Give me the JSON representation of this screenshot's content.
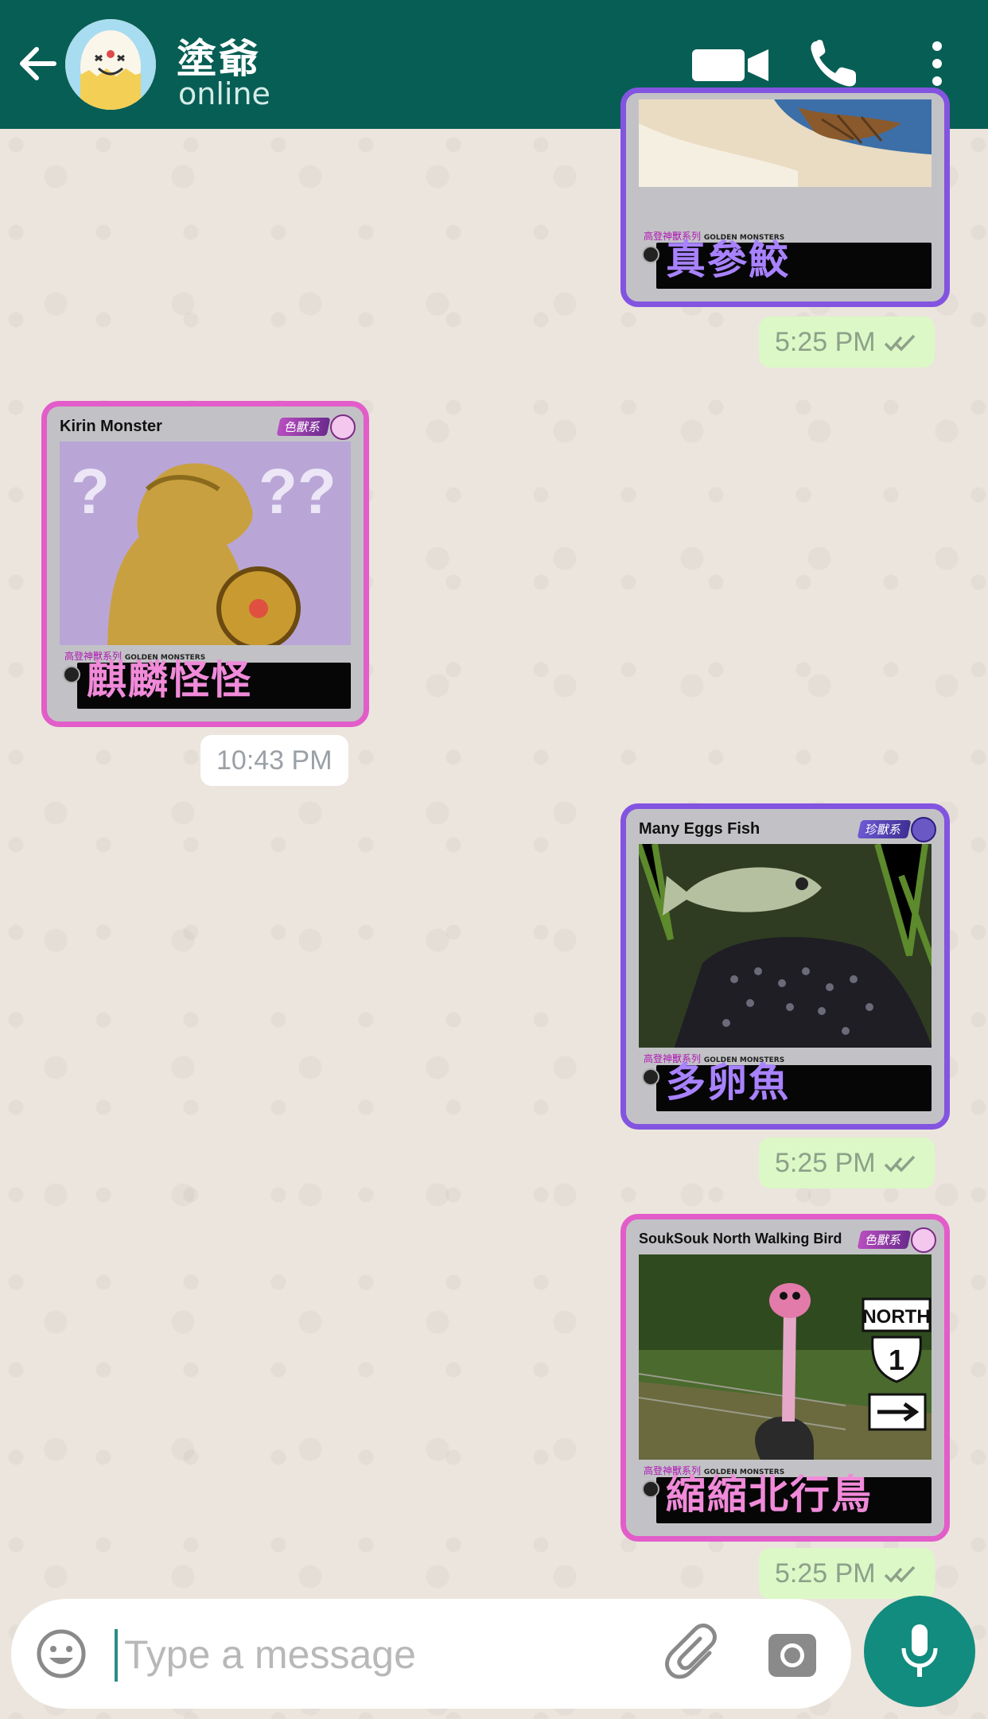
{
  "header": {
    "contact_name": "塗爺",
    "status": "online"
  },
  "composer": {
    "placeholder": "Type a message"
  },
  "messages": [
    {
      "direction": "out",
      "card": {
        "title": "",
        "name_cn": "真參鮫",
        "series": "高登神獸系列",
        "brand": "GOLDEN MONSTERS",
        "border": "purple"
      },
      "time": "5:25 PM",
      "read": true
    },
    {
      "direction": "in",
      "card": {
        "title": "Kirin Monster",
        "tag": "色獸系",
        "name_cn": "麒麟怪怪",
        "series": "高登神獸系列",
        "brand": "GOLDEN MONSTERS",
        "border": "pink"
      },
      "time": "10:43 PM"
    },
    {
      "direction": "out",
      "card": {
        "title": "Many Eggs Fish",
        "tag": "珍獸系",
        "name_cn": "多卵魚",
        "series": "高登神獸系列",
        "brand": "GOLDEN MONSTERS",
        "border": "purple"
      },
      "time": "5:25 PM",
      "read": true
    },
    {
      "direction": "out",
      "card": {
        "title": "SoukSouk North Walking Bird",
        "tag": "色獸系",
        "name_cn": "縮縮北行鳥",
        "series": "高登神獸系列",
        "brand": "GOLDEN MONSTERS",
        "border": "pink",
        "sign_text": [
          "NORTH",
          "1"
        ]
      },
      "time": "5:25 PM",
      "read": true
    }
  ],
  "colors": {
    "header": "#075e54",
    "outgoing_bubble": "#dcf8c6",
    "incoming_bubble": "#ffffff",
    "wallpaper": "#ece5dd",
    "mic_button": "#128c7e"
  },
  "icons": [
    "back-arrow-icon",
    "video-call-icon",
    "phone-icon",
    "more-vert-icon",
    "emoji-icon",
    "attach-icon",
    "camera-icon",
    "mic-icon",
    "double-check-icon"
  ]
}
